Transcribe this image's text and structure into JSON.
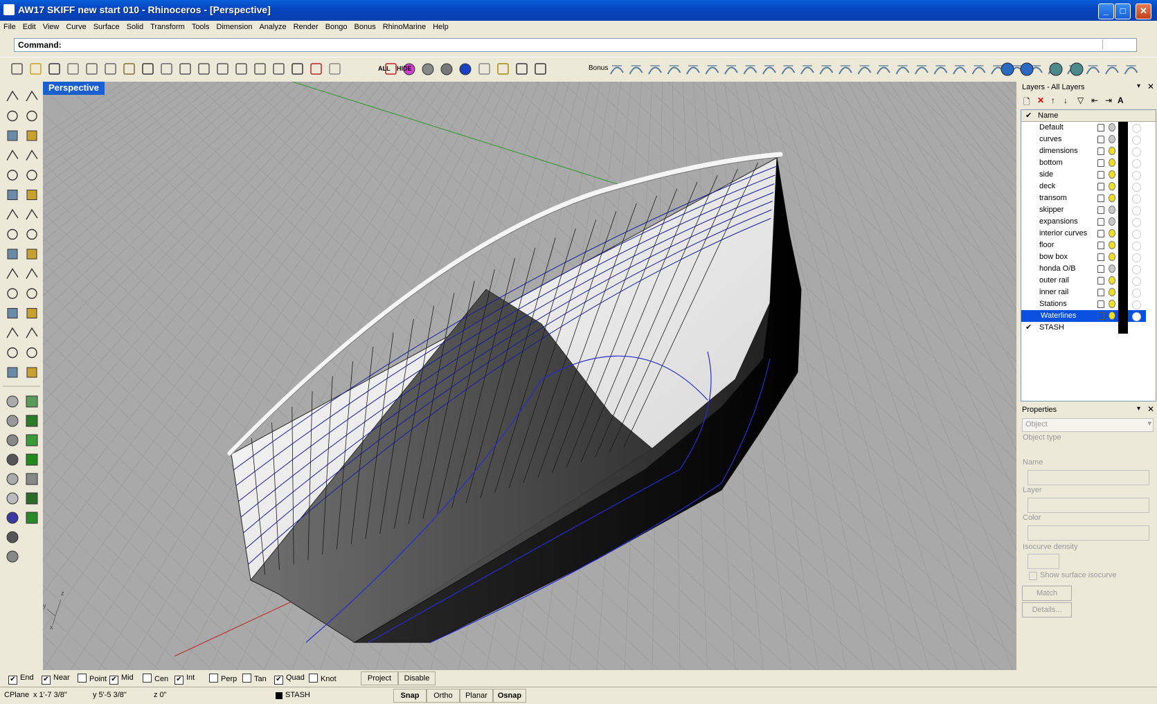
{
  "window": {
    "title": "AW17 SKIFF new start 010 - Rhinoceros - [Perspective]"
  },
  "menu": [
    "File",
    "Edit",
    "View",
    "Curve",
    "Surface",
    "Solid",
    "Transform",
    "Tools",
    "Dimension",
    "Analyze",
    "Render",
    "Bongo",
    "Bonus",
    "RhinoMarine",
    "Help"
  ],
  "command": {
    "label": "Command:",
    "value": ""
  },
  "toolbar": {
    "all_label": "ALL",
    "hide_label": "HIDE",
    "bonus_label": "Bonus"
  },
  "viewport": {
    "title": "Perspective",
    "axis_z": "z",
    "axis_y": "y",
    "axis_x": "x"
  },
  "layers": {
    "title": "Layers - All Layers",
    "column_name": "Name",
    "items": [
      {
        "name": "Default",
        "on": "gray"
      },
      {
        "name": "curves",
        "on": "gray"
      },
      {
        "name": "dimensions",
        "on": "yellow"
      },
      {
        "name": "bottom",
        "on": "yellow"
      },
      {
        "name": "side",
        "on": "yellow"
      },
      {
        "name": "deck",
        "on": "yellow"
      },
      {
        "name": "transom",
        "on": "yellow"
      },
      {
        "name": "skipper",
        "on": "gray"
      },
      {
        "name": "expansions",
        "on": "gray"
      },
      {
        "name": "interior curves",
        "on": "yellow"
      },
      {
        "name": "floor",
        "on": "yellow"
      },
      {
        "name": "bow box",
        "on": "yellow"
      },
      {
        "name": "honda O/B",
        "on": "gray"
      },
      {
        "name": "outer rail",
        "on": "yellow"
      },
      {
        "name": "inner rail",
        "on": "yellow"
      },
      {
        "name": "Stations",
        "on": "yellow"
      },
      {
        "name": "Waterlines",
        "on": "yellow",
        "selected": true
      },
      {
        "name": "STASH",
        "current": true
      }
    ],
    "current_mark": "✔"
  },
  "properties": {
    "title": "Properties",
    "object_select": "Object",
    "object_type_label": "Object type",
    "name_label": "Name",
    "layer_label": "Layer",
    "color_label": "Color",
    "isocurve_label": "Isocurve density",
    "show_isocurve_label": "Show surface isocurve",
    "match_label": "Match",
    "details_label": "Details..."
  },
  "osnap": [
    {
      "label": "End",
      "checked": true
    },
    {
      "label": "Near",
      "checked": true
    },
    {
      "label": "Point",
      "checked": false
    },
    {
      "label": "Mid",
      "checked": true
    },
    {
      "label": "Cen",
      "checked": false
    },
    {
      "label": "Int",
      "checked": true
    },
    {
      "label": "Perp",
      "checked": false
    },
    {
      "label": "Tan",
      "checked": false
    },
    {
      "label": "Quad",
      "checked": true
    },
    {
      "label": "Knot",
      "checked": false
    }
  ],
  "osnap_buttons": {
    "project": "Project",
    "disable": "Disable"
  },
  "status": {
    "cplane": "CPlane",
    "x": "x 1'-7 3/8\"",
    "y": "y 5'-5 3/8\"",
    "z": "z 0\"",
    "layer": "STASH",
    "snap": "Snap",
    "ortho": "Ortho",
    "planar": "Planar",
    "osnap": "Osnap"
  },
  "colors": {
    "titlebar": "#0546c1",
    "selection": "#0a50e0",
    "viewport_bg": "#a9a9a9",
    "hull_lines": "#1a1aa0"
  }
}
